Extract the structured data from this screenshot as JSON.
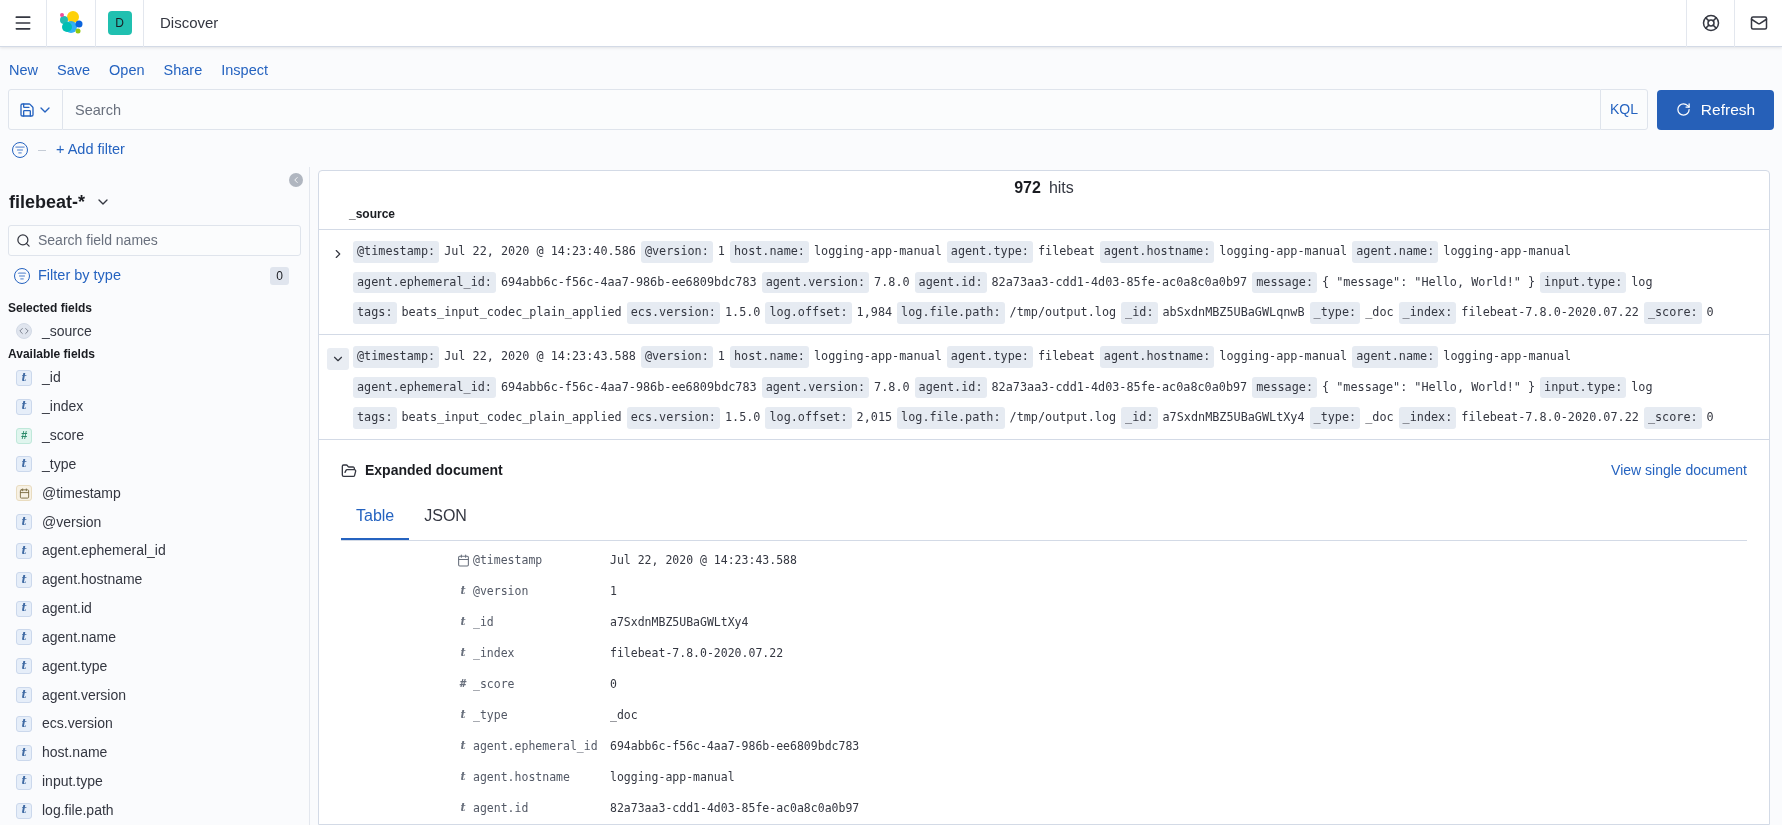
{
  "header": {
    "space_initial": "D",
    "app_title": "Discover"
  },
  "top_menu": [
    "New",
    "Save",
    "Open",
    "Share",
    "Inspect"
  ],
  "query": {
    "placeholder": "Search",
    "language": "KQL",
    "refresh_label": "Refresh"
  },
  "filters": {
    "add_label": "+ Add filter"
  },
  "sidebar": {
    "index_pattern": "filebeat-*",
    "field_search_placeholder": "Search field names",
    "filter_by_type_label": "Filter by type",
    "filter_count": "0",
    "selected_heading": "Selected fields",
    "selected_fields": [
      {
        "name": "_source",
        "kind": "source"
      }
    ],
    "available_heading": "Available fields",
    "available_fields": [
      {
        "name": "_id",
        "kind": "string",
        "glyph": "t"
      },
      {
        "name": "_index",
        "kind": "string",
        "glyph": "t"
      },
      {
        "name": "_score",
        "kind": "number",
        "glyph": "#"
      },
      {
        "name": "_type",
        "kind": "string",
        "glyph": "t"
      },
      {
        "name": "@timestamp",
        "kind": "date"
      },
      {
        "name": "@version",
        "kind": "string",
        "glyph": "t"
      },
      {
        "name": "agent.ephemeral_id",
        "kind": "string",
        "glyph": "t"
      },
      {
        "name": "agent.hostname",
        "kind": "string",
        "glyph": "t"
      },
      {
        "name": "agent.id",
        "kind": "string",
        "glyph": "t"
      },
      {
        "name": "agent.name",
        "kind": "string",
        "glyph": "t"
      },
      {
        "name": "agent.type",
        "kind": "string",
        "glyph": "t"
      },
      {
        "name": "agent.version",
        "kind": "string",
        "glyph": "t"
      },
      {
        "name": "ecs.version",
        "kind": "string",
        "glyph": "t"
      },
      {
        "name": "host.name",
        "kind": "string",
        "glyph": "t"
      },
      {
        "name": "input.type",
        "kind": "string",
        "glyph": "t"
      },
      {
        "name": "log.file.path",
        "kind": "string",
        "glyph": "t"
      }
    ]
  },
  "results": {
    "hits_count": "972",
    "hits_label": "hits",
    "column_heading": "_source",
    "documents": [
      {
        "expanded": false,
        "lines": [
          [
            {
              "key": "@timestamp:",
              "value": "Jul 22, 2020 @ 14:23:40.586"
            },
            {
              "key": "@version:",
              "value": "1"
            },
            {
              "key": "host.name:",
              "value": "logging-app-manual"
            },
            {
              "key": "agent.type:",
              "value": "filebeat"
            },
            {
              "key": "agent.hostname:",
              "value": "logging-app-manual"
            },
            {
              "key": "agent.name:",
              "value": "logging-app-manual"
            }
          ],
          [
            {
              "key": "agent.ephemeral_id:",
              "value": "694abb6c-f56c-4aa7-986b-ee6809bdc783"
            },
            {
              "key": "agent.version:",
              "value": "7.8.0"
            },
            {
              "key": "agent.id:",
              "value": "82a73aa3-cdd1-4d03-85fe-ac0a8c0a0b97"
            },
            {
              "key": "message:",
              "value": "{ \"message\": \"Hello, World!\" }"
            },
            {
              "key": "input.type:",
              "value": "log"
            }
          ],
          [
            {
              "key": "tags:",
              "value": "beats_input_codec_plain_applied"
            },
            {
              "key": "ecs.version:",
              "value": "1.5.0"
            },
            {
              "key": "log.offset:",
              "value": "1,984"
            },
            {
              "key": "log.file.path:",
              "value": "/tmp/output.log"
            },
            {
              "key": "_id:",
              "value": "abSxdnMBZ5UBaGWLqnwB"
            },
            {
              "key": "_type:",
              "value": "_doc"
            },
            {
              "key": "_index:",
              "value": "filebeat-7.8.0-2020.07.22"
            },
            {
              "key": "_score:",
              "value": "0"
            }
          ]
        ]
      },
      {
        "expanded": true,
        "lines": [
          [
            {
              "key": "@timestamp:",
              "value": "Jul 22, 2020 @ 14:23:43.588"
            },
            {
              "key": "@version:",
              "value": "1"
            },
            {
              "key": "host.name:",
              "value": "logging-app-manual"
            },
            {
              "key": "agent.type:",
              "value": "filebeat"
            },
            {
              "key": "agent.hostname:",
              "value": "logging-app-manual"
            },
            {
              "key": "agent.name:",
              "value": "logging-app-manual"
            }
          ],
          [
            {
              "key": "agent.ephemeral_id:",
              "value": "694abb6c-f56c-4aa7-986b-ee6809bdc783"
            },
            {
              "key": "agent.version:",
              "value": "7.8.0"
            },
            {
              "key": "agent.id:",
              "value": "82a73aa3-cdd1-4d03-85fe-ac0a8c0a0b97"
            },
            {
              "key": "message:",
              "value": "{ \"message\": \"Hello, World!\" }"
            },
            {
              "key": "input.type:",
              "value": "log"
            }
          ],
          [
            {
              "key": "tags:",
              "value": "beats_input_codec_plain_applied"
            },
            {
              "key": "ecs.version:",
              "value": "1.5.0"
            },
            {
              "key": "log.offset:",
              "value": "2,015"
            },
            {
              "key": "log.file.path:",
              "value": "/tmp/output.log"
            },
            {
              "key": "_id:",
              "value": "a7SxdnMBZ5UBaGWLtXy4"
            },
            {
              "key": "_type:",
              "value": "_doc"
            },
            {
              "key": "_index:",
              "value": "filebeat-7.8.0-2020.07.22"
            },
            {
              "key": "_score:",
              "value": "0"
            }
          ]
        ]
      }
    ],
    "expanded_document": {
      "title": "Expanded document",
      "view_single_link": "View single document",
      "tabs": [
        {
          "label": "Table",
          "selected": true
        },
        {
          "label": "JSON",
          "selected": false
        }
      ],
      "rows": [
        {
          "field": "@timestamp",
          "kind": "date",
          "value": "Jul 22, 2020 @ 14:23:43.588"
        },
        {
          "field": "@version",
          "kind": "string",
          "glyph": "t",
          "value": "1"
        },
        {
          "field": "_id",
          "kind": "string",
          "glyph": "t",
          "value": "a7SxdnMBZ5UBaGWLtXy4"
        },
        {
          "field": "_index",
          "kind": "string",
          "glyph": "t",
          "value": "filebeat-7.8.0-2020.07.22"
        },
        {
          "field": "_score",
          "kind": "number",
          "glyph": "#",
          "value": "0"
        },
        {
          "field": "_type",
          "kind": "string",
          "glyph": "t",
          "value": "_doc"
        },
        {
          "field": "agent.ephemeral_id",
          "kind": "string",
          "glyph": "t",
          "value": "694abb6c-f56c-4aa7-986b-ee6809bdc783"
        },
        {
          "field": "agent.hostname",
          "kind": "string",
          "glyph": "t",
          "value": "logging-app-manual"
        },
        {
          "field": "agent.id",
          "kind": "string",
          "glyph": "t",
          "value": "82a73aa3-cdd1-4d03-85fe-ac0a8c0a0b97"
        }
      ]
    }
  }
}
